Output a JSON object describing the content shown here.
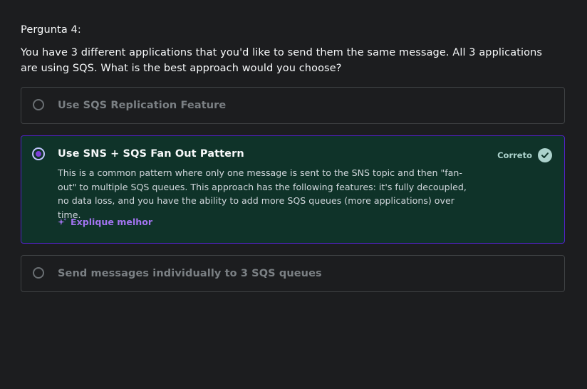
{
  "question": {
    "label": "Pergunta 4:",
    "text": "You have 3 different applications that you'd like to send them the same message. All 3 applications are using SQS. What is the best approach would you choose?"
  },
  "options": [
    {
      "title": "Use SQS Replication Feature",
      "selected": false
    },
    {
      "title": "Use SNS + SQS Fan Out Pattern",
      "selected": true,
      "description": "This is a common pattern where only one message is sent to the SNS topic and then \"fan-out\" to multiple SQS queues. This approach has the following features: it's fully decoupled, no data loss, and you have the ability to add more SQS queues (more applications) over time.",
      "status_label": "Correto",
      "explain_label": "Explique melhor"
    },
    {
      "title": "Send messages individually to 3 SQS queues",
      "selected": false
    }
  ],
  "icons": {
    "status": "check-circle-icon",
    "explain": "sparkle-icon"
  },
  "colors": {
    "background": "#1c1d1f",
    "selected_bg": "#0f3329",
    "selected_border": "#5022c3",
    "correct": "#acd2cc",
    "accent": "#a273f0"
  }
}
